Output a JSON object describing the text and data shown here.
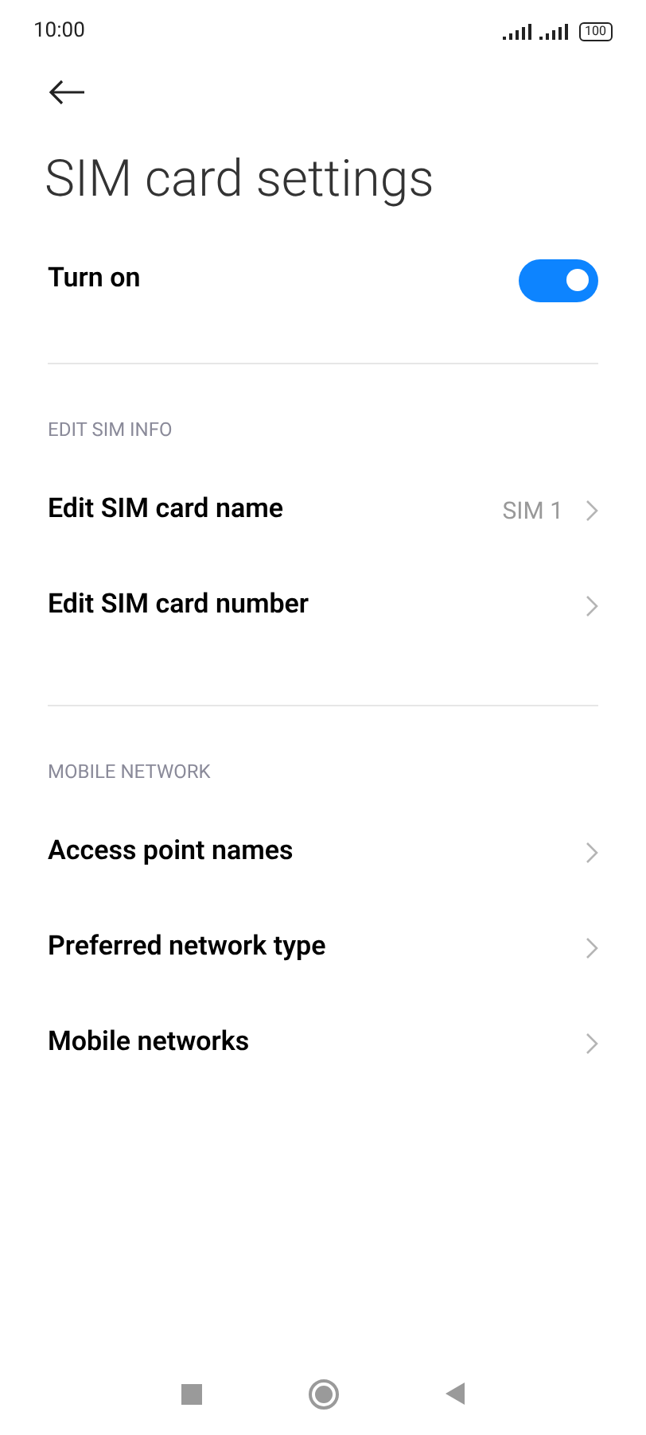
{
  "status_bar": {
    "time": "10:00",
    "battery": "100"
  },
  "title": "SIM card settings",
  "toggle": {
    "label": "Turn on",
    "on": true
  },
  "sections": [
    {
      "header": "EDIT SIM INFO",
      "items": [
        {
          "label": "Edit SIM card name",
          "value": "SIM 1"
        },
        {
          "label": "Edit SIM card number"
        }
      ]
    },
    {
      "header": "MOBILE NETWORK",
      "items": [
        {
          "label": "Access point names"
        },
        {
          "label": "Preferred network type"
        },
        {
          "label": "Mobile networks"
        }
      ]
    }
  ]
}
